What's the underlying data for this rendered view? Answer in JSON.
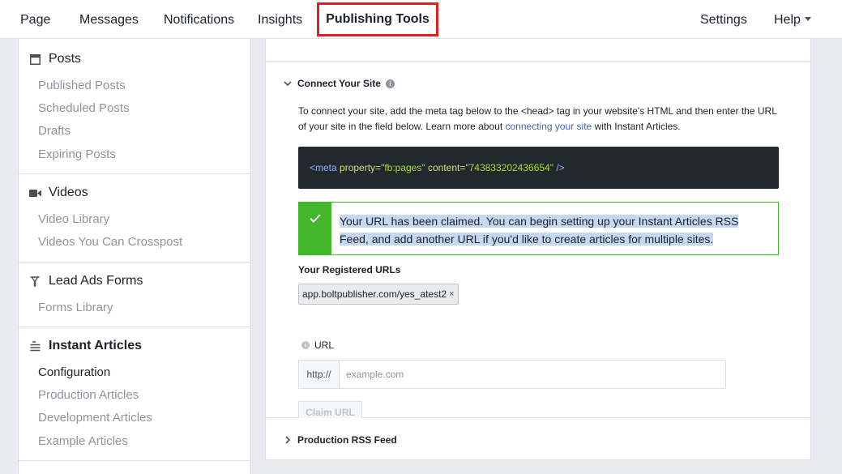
{
  "topnav": {
    "page": "Page",
    "messages": "Messages",
    "notifications": "Notifications",
    "insights": "Insights",
    "publishing_tools": "Publishing Tools",
    "settings": "Settings",
    "help": "Help"
  },
  "sidebar": {
    "posts": {
      "header": "Posts",
      "items": [
        "Published Posts",
        "Scheduled Posts",
        "Drafts",
        "Expiring Posts"
      ]
    },
    "videos": {
      "header": "Videos",
      "items": [
        "Video Library",
        "Videos You Can Crosspost"
      ]
    },
    "lead_ads": {
      "header": "Lead Ads Forms",
      "items": [
        "Forms Library"
      ]
    },
    "instant_articles": {
      "header": "Instant Articles",
      "items": [
        "Configuration",
        "Production Articles",
        "Development Articles",
        "Example Articles"
      ]
    }
  },
  "connect": {
    "title": "Connect Your Site",
    "desc_before": "To connect your site, add the meta tag below to the <head> tag in your website's HTML and then enter the URL of your site in the field below. Learn more about ",
    "desc_link": "connecting your site",
    "desc_after": " with Instant Articles.",
    "code": {
      "open": "<meta",
      "property_attr": "property=",
      "property_val": "\"fb:pages\"",
      "content_attr": "content=",
      "content_val": "\"743833202436654\"",
      "close": "/>"
    },
    "success_msg": "Your URL has been claimed. You can begin setting up your Instant Articles RSS Feed, and add another URL if you'd like to create articles for multiple sites.",
    "registered_label": "Your Registered URLs",
    "registered_urls": [
      "app.boltpublisher.com/yes_atest2"
    ],
    "url_label": "URL",
    "url_prefix": "http://",
    "url_placeholder": "example.com",
    "url_value": "",
    "claim_button": "Claim URL"
  },
  "rss": {
    "title": "Production RSS Feed"
  },
  "colors": {
    "accent_red": "#e02020",
    "success_green": "#42b72a",
    "link_blue": "#4267b2"
  }
}
